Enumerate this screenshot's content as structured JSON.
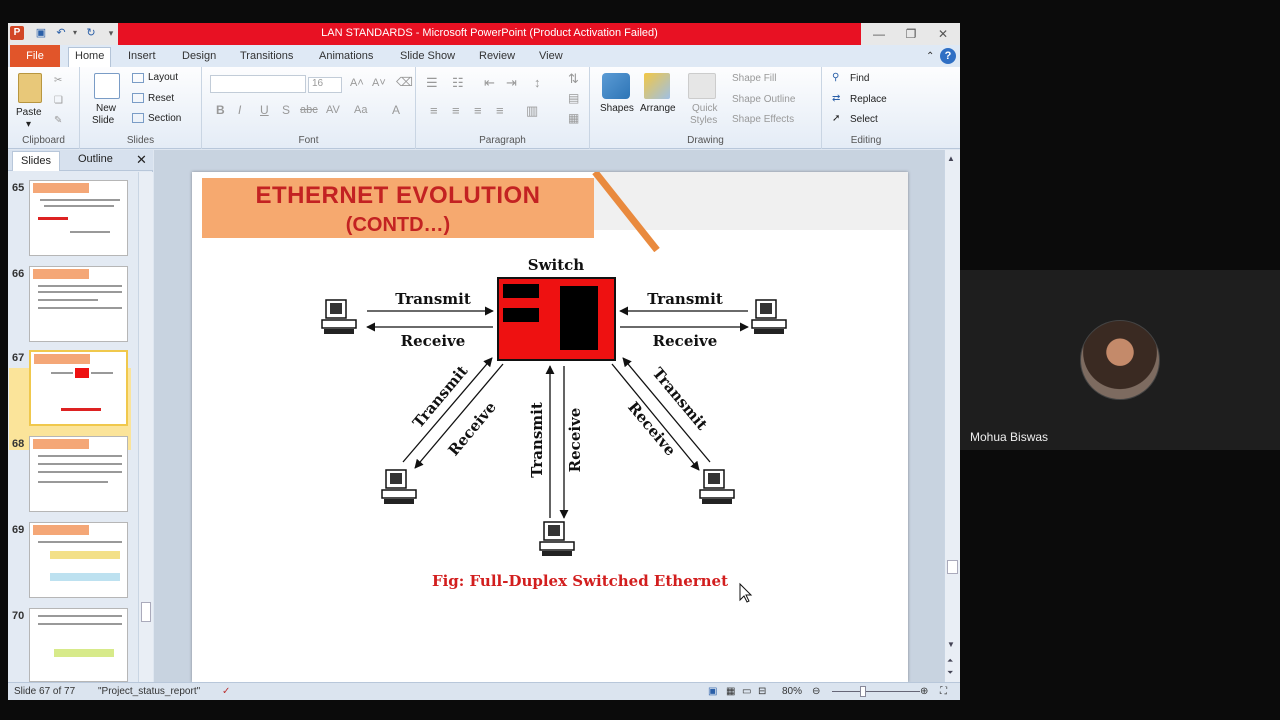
{
  "window": {
    "title": "LAN STANDARDS  -  Microsoft PowerPoint (Product Activation Failed)",
    "app_icon": "P"
  },
  "ribbon_tabs": [
    "File",
    "Home",
    "Insert",
    "Design",
    "Transitions",
    "Animations",
    "Slide Show",
    "Review",
    "View"
  ],
  "ribbon": {
    "clipboard": {
      "paste": "Paste",
      "group": "Clipboard"
    },
    "slides": {
      "new_slide_1": "New",
      "new_slide_2": "Slide",
      "layout": "Layout",
      "reset": "Reset",
      "section": "Section",
      "group": "Slides"
    },
    "font": {
      "size": "16",
      "group": "Font",
      "bold": "B",
      "italic": "I",
      "underline": "U",
      "shadow": "S",
      "strike": "abc",
      "spacing": "AV",
      "case": "Aa",
      "color": "A"
    },
    "paragraph": {
      "group": "Paragraph"
    },
    "drawing": {
      "shapes": "Shapes",
      "arrange": "Arrange",
      "quick_styles_1": "Quick",
      "quick_styles_2": "Styles",
      "shape_fill": "Shape Fill",
      "shape_outline": "Shape Outline",
      "shape_effects": "Shape Effects",
      "group": "Drawing"
    },
    "editing": {
      "find": "Find",
      "replace": "Replace",
      "select": "Select",
      "group": "Editing"
    }
  },
  "panel": {
    "tabs": [
      "Slides",
      "Outline"
    ],
    "thumbs": [
      "65",
      "66",
      "67",
      "68",
      "69",
      "70"
    ],
    "selected": "67"
  },
  "slide": {
    "title_line1": "ETHERNET EVOLUTION",
    "title_line2": "(CONTD…)",
    "switch_label": "Switch",
    "transmit": "Transmit",
    "receive": "Receive",
    "caption": "Fig: Full-Duplex Switched Ethernet"
  },
  "status": {
    "slide_of": "Slide 67 of 77",
    "theme": "\"Project_status_report\"",
    "zoom": "80%"
  },
  "video": {
    "participant": "Mohua Biswas"
  },
  "colors": {
    "title_bar": "#e81123",
    "file_tab": "#e1552a",
    "slide_title": "#c32222",
    "title_box": "#f6a96f",
    "switch": "#ee1111",
    "caption": "#d21e1e"
  }
}
